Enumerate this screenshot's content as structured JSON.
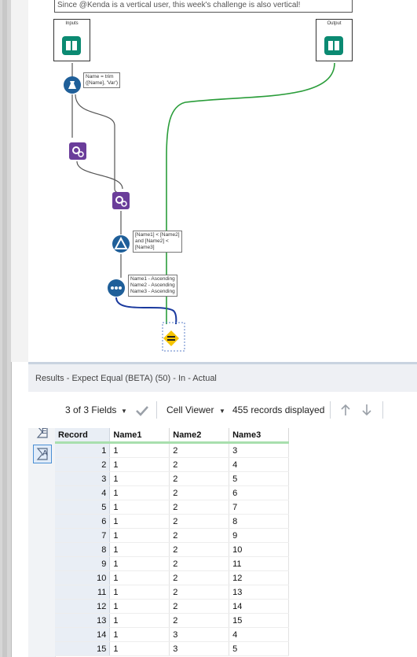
{
  "canvas": {
    "comment": "Since @Kenda is a vertical user, this week's challenge is also vertical!",
    "input_label": "Inputs",
    "output_label": "Output",
    "formula_anno": "Name = trim\n([Name], 'Var')",
    "filter_anno": "[Name1] < [Name2]\nand [Name2] <\n[Name3]",
    "sort_anno": "Name1 - Ascending\nName2 - Ascending\nName3 - Ascending"
  },
  "results": {
    "title": "Results - Expect Equal (BETA) (50) - In - Actual",
    "fields_label": "3 of 3 Fields",
    "viewer_label": "Cell Viewer",
    "records_label": "455 records displayed",
    "side_e": "E",
    "side_a": "A"
  },
  "table": {
    "headers": [
      "Record",
      "Name1",
      "Name2",
      "Name3"
    ],
    "rows": [
      [
        "1",
        "1",
        "2",
        "3"
      ],
      [
        "2",
        "1",
        "2",
        "4"
      ],
      [
        "3",
        "1",
        "2",
        "5"
      ],
      [
        "4",
        "1",
        "2",
        "6"
      ],
      [
        "5",
        "1",
        "2",
        "7"
      ],
      [
        "6",
        "1",
        "2",
        "8"
      ],
      [
        "7",
        "1",
        "2",
        "9"
      ],
      [
        "8",
        "1",
        "2",
        "10"
      ],
      [
        "9",
        "1",
        "2",
        "11"
      ],
      [
        "10",
        "1",
        "2",
        "12"
      ],
      [
        "11",
        "1",
        "2",
        "13"
      ],
      [
        "12",
        "1",
        "2",
        "14"
      ],
      [
        "13",
        "1",
        "2",
        "15"
      ],
      [
        "14",
        "1",
        "3",
        "4"
      ],
      [
        "15",
        "1",
        "3",
        "5"
      ]
    ]
  },
  "colors": {
    "accent_green": "#2a9d3a",
    "connector_blue": "#1a3a9e",
    "tool_purple": "#6a3d9a",
    "tool_blue": "#1f5f99"
  }
}
